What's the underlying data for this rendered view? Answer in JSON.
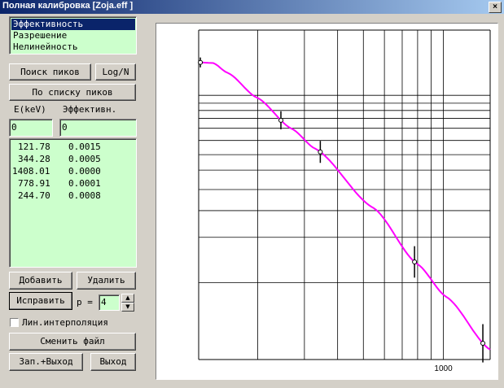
{
  "window": {
    "title": "Полная калибровка [Zoja.eff ]",
    "close_label": "×"
  },
  "mode_list": [
    "Эффективность",
    "Разрешение",
    "Нелинейность"
  ],
  "buttons": {
    "peak_search": "Поиск пиков",
    "log_n": "Log/N",
    "by_peak_list": "По списку пиков",
    "add": "Добавить",
    "delete": "Удалить",
    "fix": "Исправить",
    "change_file": "Сменить файл",
    "save_exit": "Зап.+Выход",
    "exit": "Выход"
  },
  "columns": {
    "energy": "E(keV)",
    "efficiency": "Эффективн."
  },
  "inputs": {
    "energy_value": "0",
    "efficiency_value": "0"
  },
  "peaks": [
    {
      "energy": "121.78",
      "eff": "0.0015"
    },
    {
      "energy": "344.28",
      "eff": "0.0005"
    },
    {
      "energy": "1408.01",
      "eff": "0.0000"
    },
    {
      "energy": "778.91",
      "eff": "0.0001"
    },
    {
      "energy": "244.70",
      "eff": "0.0008"
    }
  ],
  "poly": {
    "label": "p =",
    "value": "4"
  },
  "interp": {
    "label": "Лин.интерполяция",
    "checked": false
  },
  "chart_data": {
    "type": "line",
    "xscale": "log",
    "yscale": "log",
    "xlim": [
      120,
      1500
    ],
    "tick_labels": [
      "1000"
    ],
    "points": [
      {
        "x": 121.78
      },
      {
        "x": 244.7
      },
      {
        "x": 344.28
      },
      {
        "x": 778.91
      },
      {
        "x": 1408.01
      }
    ],
    "curve_color": "#ff00ff",
    "grid": true
  }
}
